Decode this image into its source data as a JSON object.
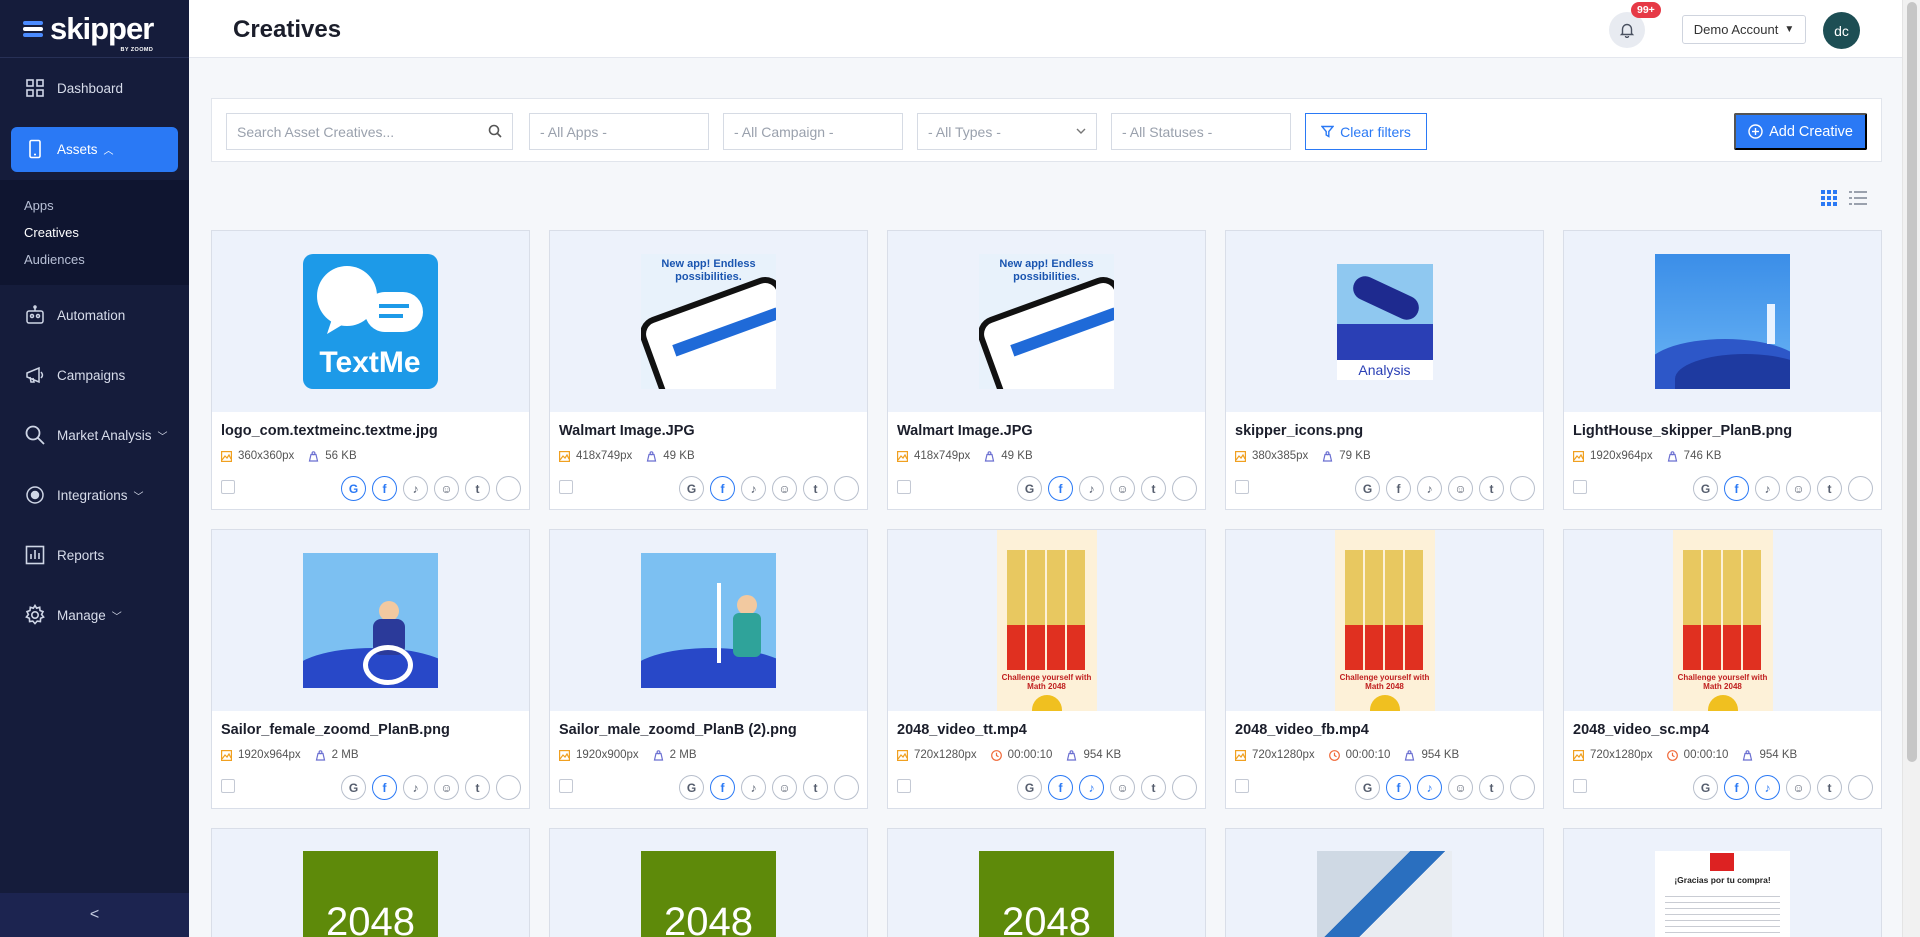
{
  "brand": {
    "name": "skipper",
    "sub": "BY ZOOMD"
  },
  "sidebar": {
    "items": [
      {
        "label": "Dashboard",
        "icon": "grid-icon"
      },
      {
        "label": "Assets",
        "icon": "phone-icon"
      },
      {
        "label": "Automation",
        "icon": "robot-icon"
      },
      {
        "label": "Campaigns",
        "icon": "megaphone-icon"
      },
      {
        "label": "Market Analysis",
        "icon": "magnifier-icon"
      },
      {
        "label": "Integrations",
        "icon": "target-icon"
      },
      {
        "label": "Reports",
        "icon": "bar-chart-icon"
      },
      {
        "label": "Manage",
        "icon": "gear-icon"
      }
    ],
    "submenu": [
      "Apps",
      "Creatives",
      "Audiences"
    ],
    "collapse_label": "<"
  },
  "header": {
    "title": "Creatives",
    "notification_count": "99+",
    "account": "Demo Account",
    "avatar": "dc"
  },
  "filters": {
    "search_placeholder": "Search Asset Creatives...",
    "apps": "- All Apps -",
    "campaign": "- All Campaign -",
    "types": "- All Types -",
    "statuses": "- All Statuses -",
    "clear": "Clear filters",
    "add": "Add Creative"
  },
  "colors": {
    "accent": "#2a79f5",
    "sidebar": "#151c3b",
    "badge": "#e63946"
  },
  "cards": [
    {
      "name": "logo_com.textmeinc.textme.jpg",
      "dims": "360x360px",
      "size": "56 KB",
      "thumb": "textme-logo"
    },
    {
      "name": "Walmart Image.JPG",
      "dims": "418x749px",
      "size": "49 KB",
      "thumb": "walmart-ad",
      "thumb_text": "New app! Endless possibilities."
    },
    {
      "name": "Walmart Image.JPG",
      "dims": "418x749px",
      "size": "49 KB",
      "thumb": "walmart-ad",
      "thumb_text": "New app! Endless possibilities."
    },
    {
      "name": "skipper_icons.png",
      "dims": "380x385px",
      "size": "79 KB",
      "thumb": "telescope-analysis",
      "thumb_text": "Analysis"
    },
    {
      "name": "LightHouse_skipper_PlanB.png",
      "dims": "1920x964px",
      "size": "746 KB",
      "thumb": "lighthouse-waves"
    },
    {
      "name": "Sailor_female_zoomd_PlanB.png",
      "dims": "1920x964px",
      "size": "2 MB",
      "thumb": "sailor-female"
    },
    {
      "name": "Sailor_male_zoomd_PlanB (2).png",
      "dims": "1920x900px",
      "size": "2 MB",
      "thumb": "sailor-male"
    },
    {
      "name": "2048_video_tt.mp4",
      "dims": "720x1280px",
      "duration": "00:00:10",
      "size": "954 KB",
      "thumb": "game-2048",
      "thumb_text": "Challenge yourself with Math 2048"
    },
    {
      "name": "2048_video_fb.mp4",
      "dims": "720x1280px",
      "duration": "00:00:10",
      "size": "954 KB",
      "thumb": "game-2048",
      "thumb_text": "Challenge yourself with Math 2048"
    },
    {
      "name": "2048_video_sc.mp4",
      "dims": "720x1280px",
      "duration": "00:00:10",
      "size": "954 KB",
      "thumb": "game-2048",
      "thumb_text": "Challenge yourself with Math 2048"
    }
  ],
  "partial_cards": [
    {
      "thumb": "green-2048",
      "thumb_text": "2048"
    },
    {
      "thumb": "green-2048",
      "thumb_text": "2048"
    },
    {
      "thumb": "green-2048",
      "thumb_text": "2048"
    },
    {
      "thumb": "office-photo"
    },
    {
      "thumb": "receipt",
      "thumb_text": "¡Gracias por tu compra!"
    }
  ],
  "platforms": [
    "google-icon",
    "facebook-icon",
    "tiktok-icon",
    "snapchat-icon",
    "twitter-icon",
    "apple-icon"
  ]
}
